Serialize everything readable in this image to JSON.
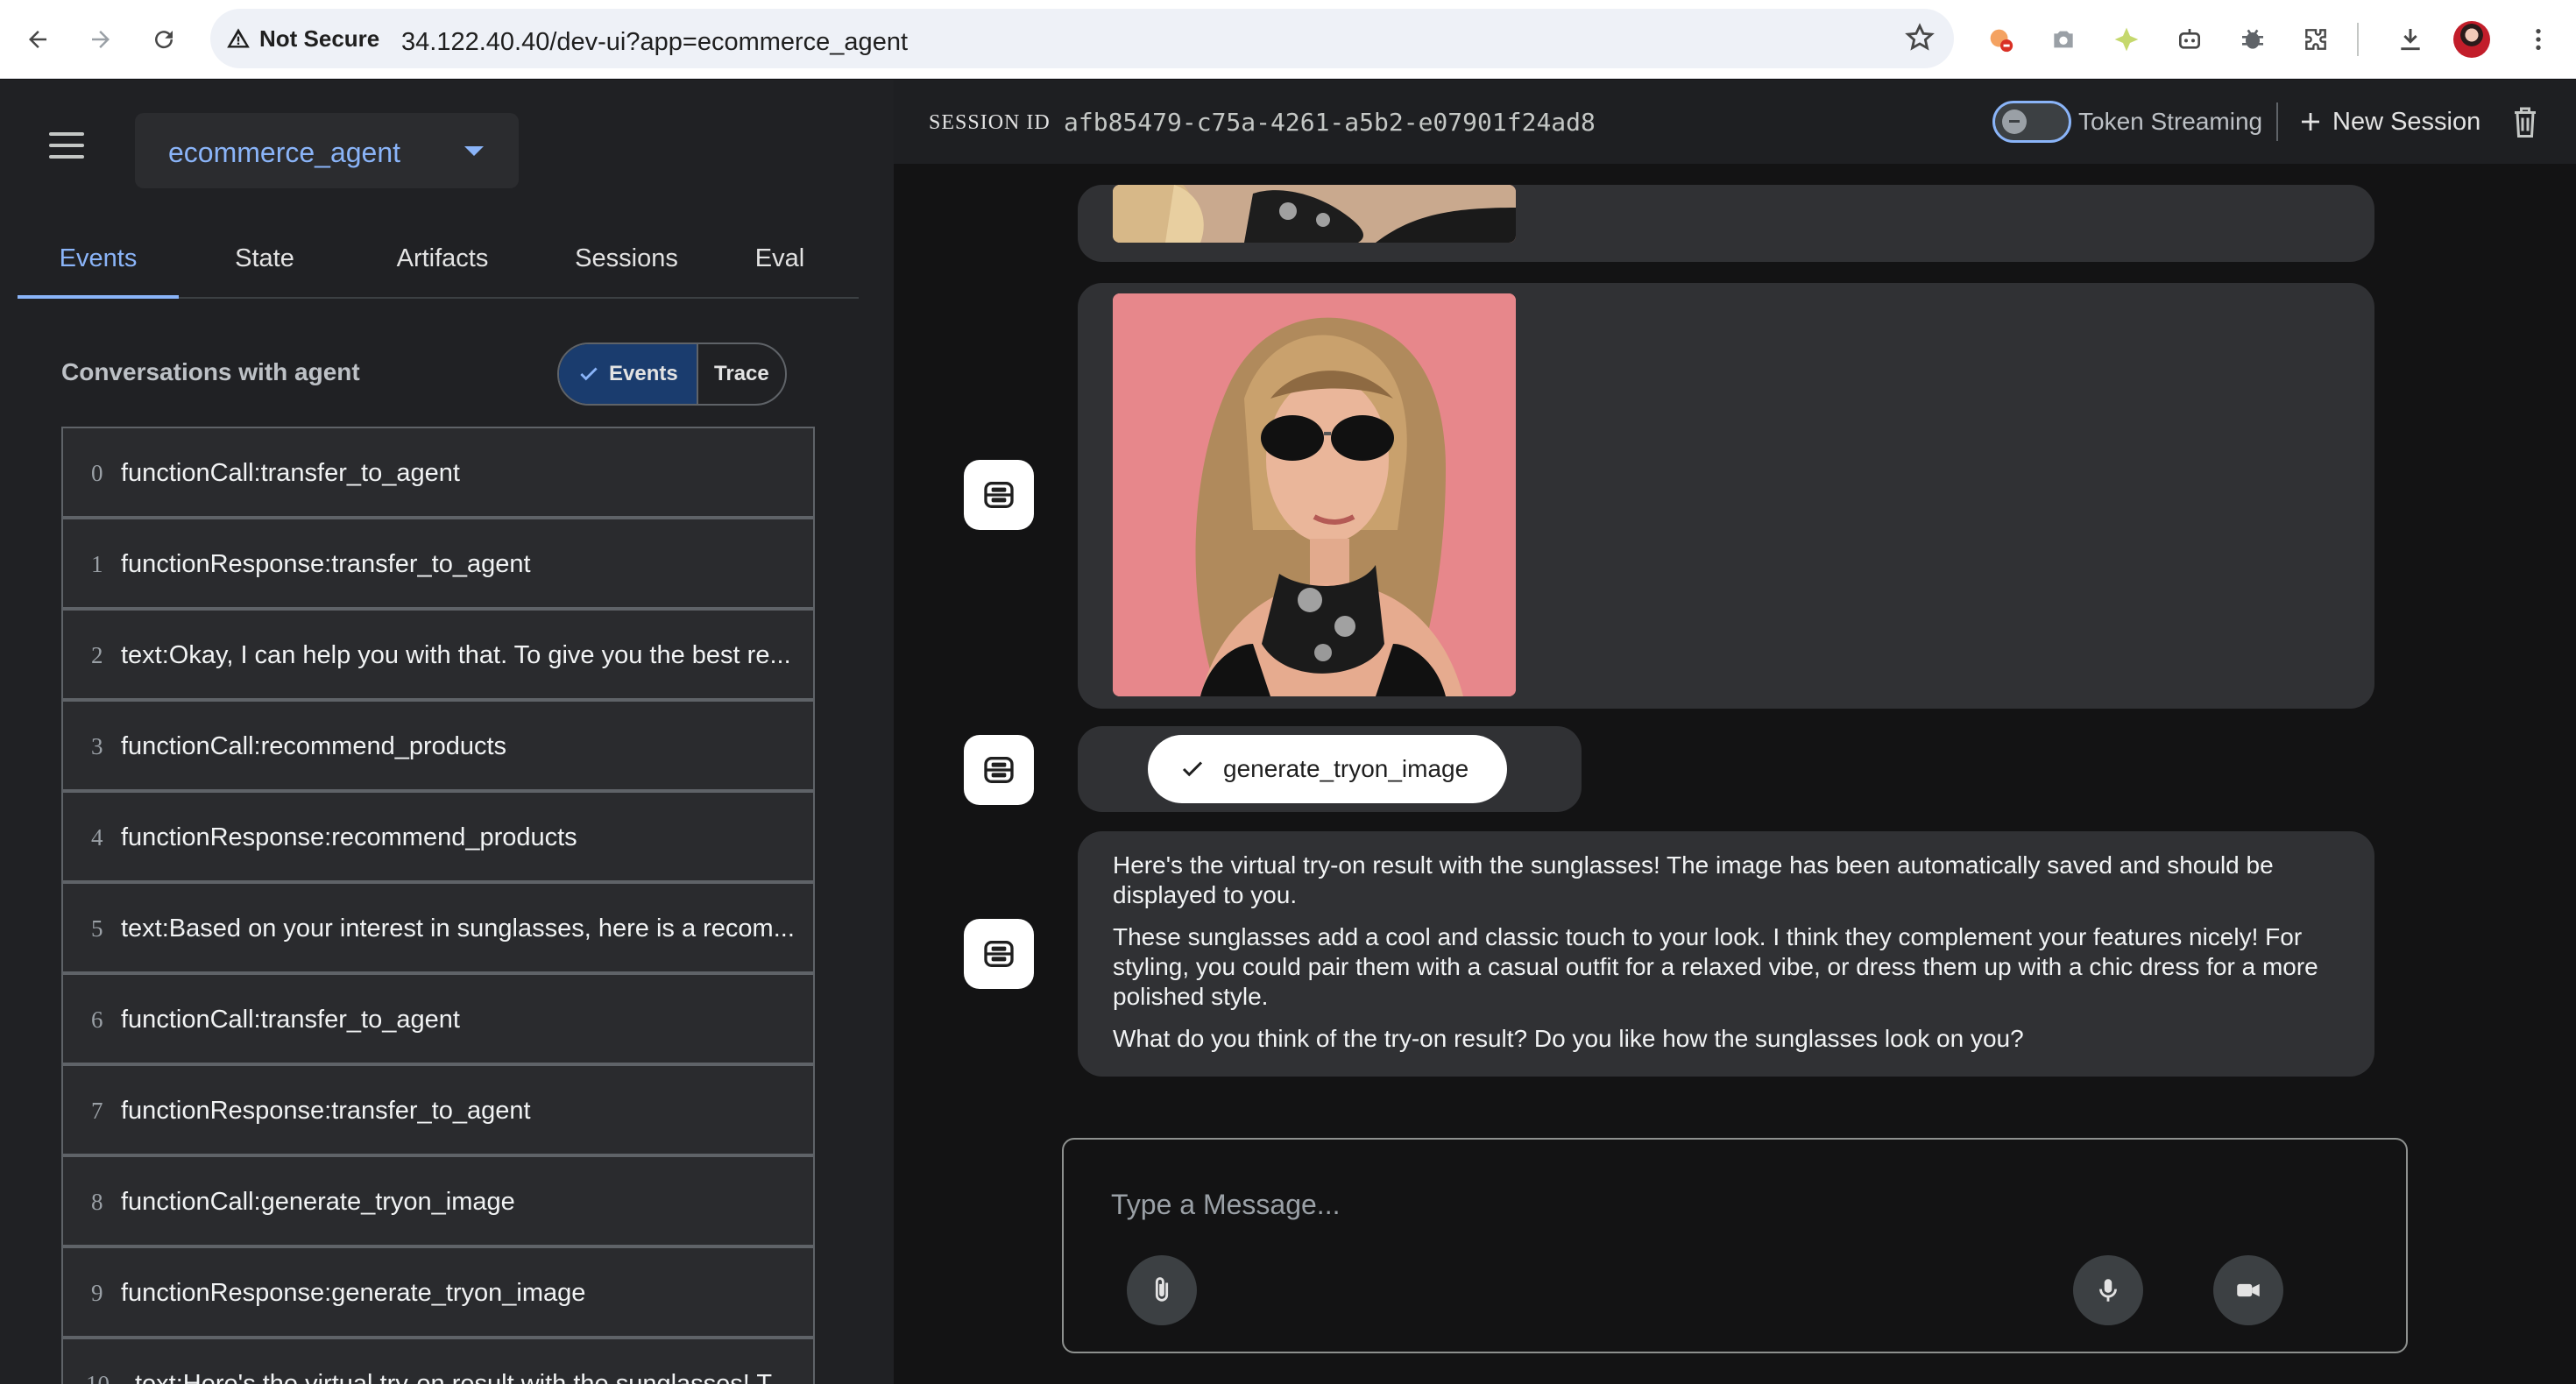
{
  "browser": {
    "security_label": "Not Secure",
    "url": "34.122.40.40/dev-ui?app=ecommerce_agent"
  },
  "sidebar": {
    "app_name": "ecommerce_agent",
    "tabs": [
      "Events",
      "State",
      "Artifacts",
      "Sessions",
      "Eval"
    ],
    "active_tab": "Events",
    "conversations_title": "Conversations with agent",
    "toggle": {
      "events": "Events",
      "trace": "Trace",
      "selected": "Events"
    },
    "events": [
      {
        "index": "0",
        "label": "functionCall:transfer_to_agent"
      },
      {
        "index": "1",
        "label": "functionResponse:transfer_to_agent"
      },
      {
        "index": "2",
        "label": "text:Okay, I can help you with that. To give you the best re..."
      },
      {
        "index": "3",
        "label": "functionCall:recommend_products"
      },
      {
        "index": "4",
        "label": "functionResponse:recommend_products"
      },
      {
        "index": "5",
        "label": "text:Based on your interest in sunglasses, here is a recom..."
      },
      {
        "index": "6",
        "label": "functionCall:transfer_to_agent"
      },
      {
        "index": "7",
        "label": "functionResponse:transfer_to_agent"
      },
      {
        "index": "8",
        "label": "functionCall:generate_tryon_image"
      },
      {
        "index": "9",
        "label": "functionResponse:generate_tryon_image"
      },
      {
        "index": "10",
        "label": "text:Here's the virtual try-on result with the sunglasses! T..."
      }
    ]
  },
  "header": {
    "session_label": "SESSION ID",
    "session_id": "afb85479-c75a-4261-a5b2-e07901f24ad8",
    "token_streaming_label": "Token Streaming",
    "token_streaming_on": false,
    "new_session_label": "New Session"
  },
  "chat": {
    "tool_call": "generate_tryon_image",
    "message_paragraphs": [
      "Here's the virtual try-on result with the sunglasses! The image has been automatically saved and should be displayed to you.",
      "These sunglasses add a cool and classic touch to your look. I think they complement your features nicely! For styling, you could pair them with a casual outfit for a relaxed vibe, or dress them up with a chic dress for a more polished style.",
      "What do you think of the try-on result? Do you like how the sunglasses look on you?"
    ],
    "input_placeholder": "Type a Message..."
  },
  "colors": {
    "accent": "#8ab4f8",
    "panel": "#202124",
    "bubble": "#303134",
    "background": "#131314"
  }
}
